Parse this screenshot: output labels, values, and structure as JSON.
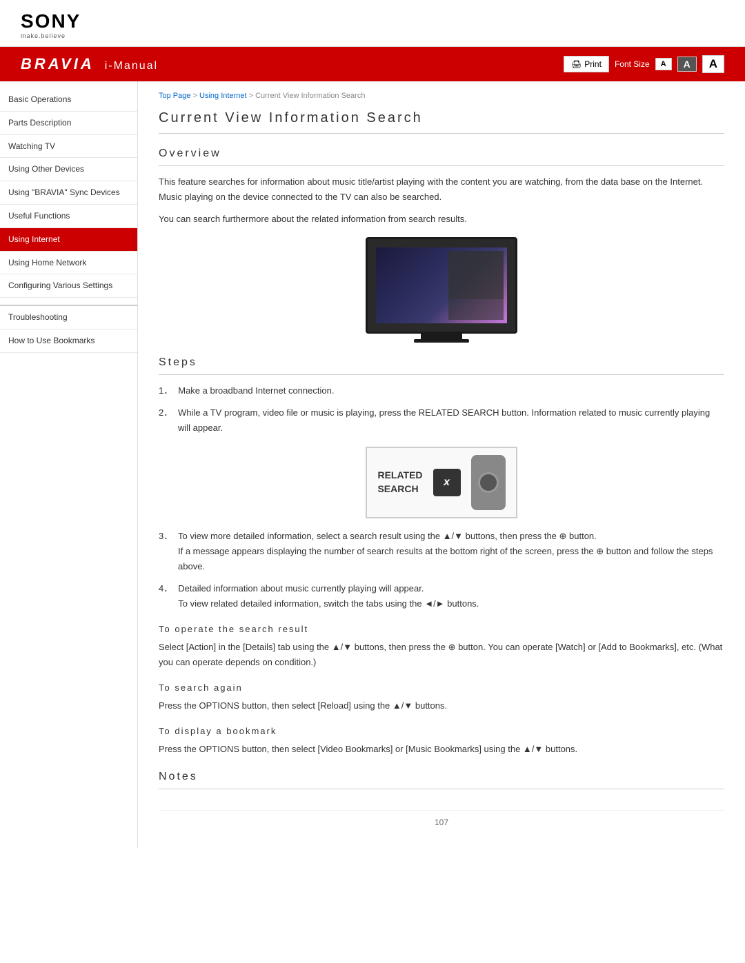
{
  "header": {
    "sony_logo": "SONY",
    "tagline": "make.believe",
    "bravia": "BRAVIA",
    "imanual": "i-Manual",
    "print_label": "Print",
    "font_size_label": "Font Size",
    "font_a_small": "A",
    "font_a_medium": "A",
    "font_a_large": "A"
  },
  "breadcrumb": {
    "top_page": "Top Page",
    "separator1": " > ",
    "using_internet": "Using Internet",
    "separator2": " > ",
    "current": "Current View Information Search"
  },
  "sidebar": {
    "items": [
      {
        "label": "Basic Operations",
        "active": false
      },
      {
        "label": "Parts Description",
        "active": false
      },
      {
        "label": "Watching TV",
        "active": false
      },
      {
        "label": "Using Other Devices",
        "active": false
      },
      {
        "label": "Using \"BRAVIA\" Sync Devices",
        "active": false
      },
      {
        "label": "Useful Functions",
        "active": false
      },
      {
        "label": "Using Internet",
        "active": true
      },
      {
        "label": "Using Home Network",
        "active": false
      },
      {
        "label": "Configuring Various Settings",
        "active": false
      },
      {
        "label": "Troubleshooting",
        "active": false
      },
      {
        "label": "How to Use Bookmarks",
        "active": false
      }
    ]
  },
  "content": {
    "page_title": "Current View Information Search",
    "overview_heading": "Overview",
    "overview_p1": "This feature searches for information about music title/artist playing with the content you are watching, from the data base on the Internet. Music playing on the device connected to the TV can also be searched.",
    "overview_p2": "You can search furthermore about the related information from search results.",
    "steps_heading": "Steps",
    "steps": [
      {
        "num": "1．",
        "text": "Make a broadband Internet connection."
      },
      {
        "num": "2．",
        "text": "While a TV program, video file or music is playing, press the RELATED SEARCH button. Information related to music currently playing will appear."
      },
      {
        "num": "3．",
        "text": "To view more detailed information, select a search result using the ▲/▼ buttons, then press the ⊕ button.\nIf a message appears displaying the number of search results at the bottom right of the screen, press the ⊕ button and follow the steps above."
      },
      {
        "num": "4．",
        "text": "Detailed information about music currently playing will appear.\nTo view related detailed information, switch the tabs using the ◄/► buttons."
      }
    ],
    "related_search_label": "RELATED\nSEARCH",
    "sub_section1_heading": "To operate the search result",
    "sub_section1_text": "Select [Action] in the [Details] tab using the ▲/▼ buttons, then press the ⊕ button. You can operate [Watch] or [Add to Bookmarks], etc. (What you can operate depends on condition.)",
    "sub_section2_heading": "To search again",
    "sub_section2_text": "Press the OPTIONS button, then select [Reload] using the ▲/▼ buttons.",
    "sub_section3_heading": "To display a bookmark",
    "sub_section3_text": "Press the OPTIONS button, then select [Video Bookmarks] or [Music Bookmarks] using the ▲/▼ buttons.",
    "notes_heading": "Notes",
    "page_number": "107"
  }
}
